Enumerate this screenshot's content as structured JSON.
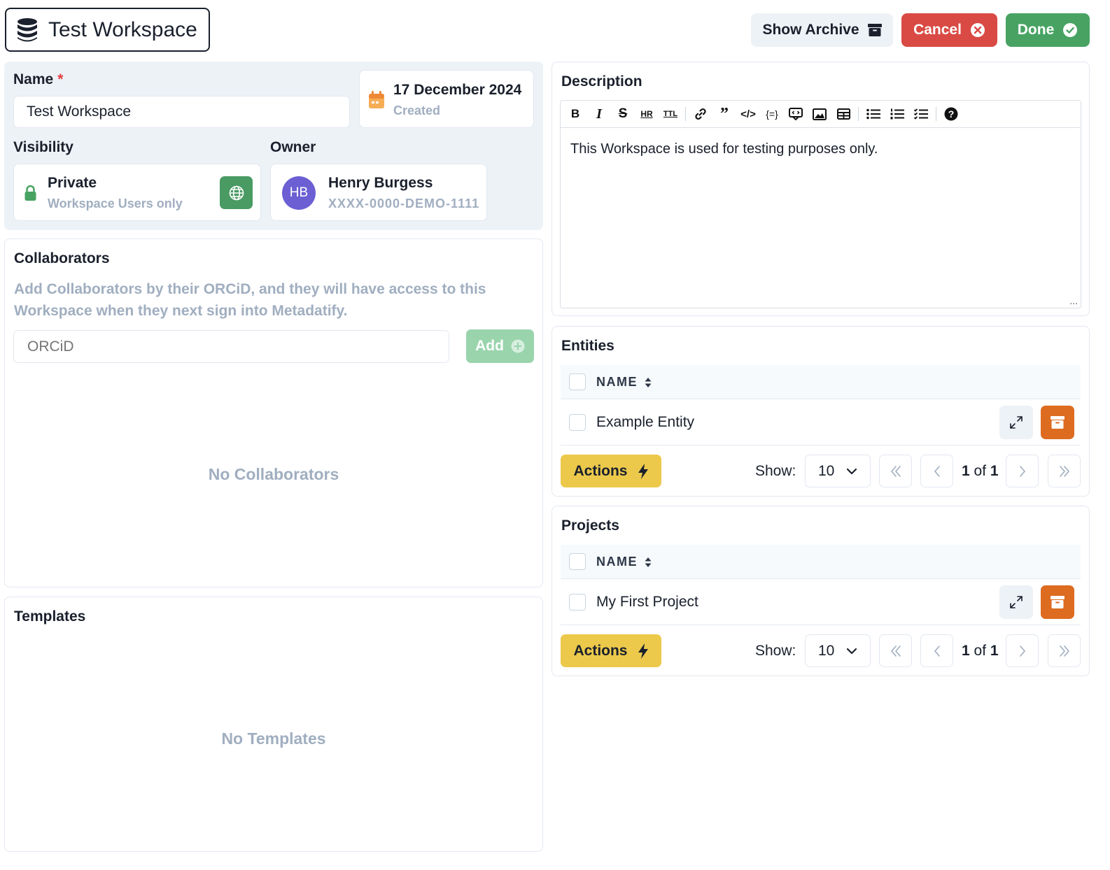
{
  "header": {
    "title": "Test Workspace",
    "show_archive_label": "Show Archive",
    "cancel_label": "Cancel",
    "done_label": "Done"
  },
  "details": {
    "name_label": "Name",
    "required_mark": "*",
    "name_value": "Test Workspace",
    "created_date": "17 December 2024",
    "created_label": "Created",
    "visibility_label": "Visibility",
    "visibility_value": "Private",
    "visibility_sub": "Workspace Users only",
    "owner_label": "Owner",
    "owner_initials": "HB",
    "owner_name": "Henry Burgess",
    "owner_orcid": "XXXX-0000-DEMO-1111"
  },
  "collaborators": {
    "title": "Collaborators",
    "help": "Add Collaborators by their ORCiD, and they will have access to this Workspace when they next sign into Metadatify.",
    "input_placeholder": "ORCiD",
    "add_label": "Add",
    "empty": "No Collaborators"
  },
  "templates": {
    "title": "Templates",
    "empty": "No Templates"
  },
  "description": {
    "title": "Description",
    "text": "This Workspace is used for testing purposes only.",
    "resize_glyph": "..."
  },
  "entities": {
    "title": "Entities",
    "column": "NAME",
    "rows": [
      {
        "name": "Example Entity"
      }
    ],
    "actions_label": "Actions",
    "show_label": "Show:",
    "page_size": "10",
    "page_current": "1",
    "page_of": "of",
    "page_total": "1"
  },
  "projects": {
    "title": "Projects",
    "column": "NAME",
    "rows": [
      {
        "name": "My First Project"
      }
    ],
    "actions_label": "Actions",
    "show_label": "Show:",
    "page_size": "10",
    "page_current": "1",
    "page_of": "of",
    "page_total": "1"
  },
  "colors": {
    "cancel": "#d94a44",
    "done": "#48a363",
    "actions": "#ecc94b",
    "archive": "#dd6b20",
    "avatar": "#6b5fd3",
    "visibility_toggle": "#4a9a63"
  },
  "icons": [
    "database-icon",
    "archive-icon",
    "close-circle-icon",
    "check-circle-icon",
    "calendar-icon",
    "lock-icon",
    "globe-icon",
    "plus-circle-icon",
    "expand-icon",
    "bolt-icon",
    "chevron-down-icon",
    "double-left-icon",
    "left-icon",
    "right-icon",
    "double-right-icon",
    "sort-icon",
    "help-icon"
  ]
}
